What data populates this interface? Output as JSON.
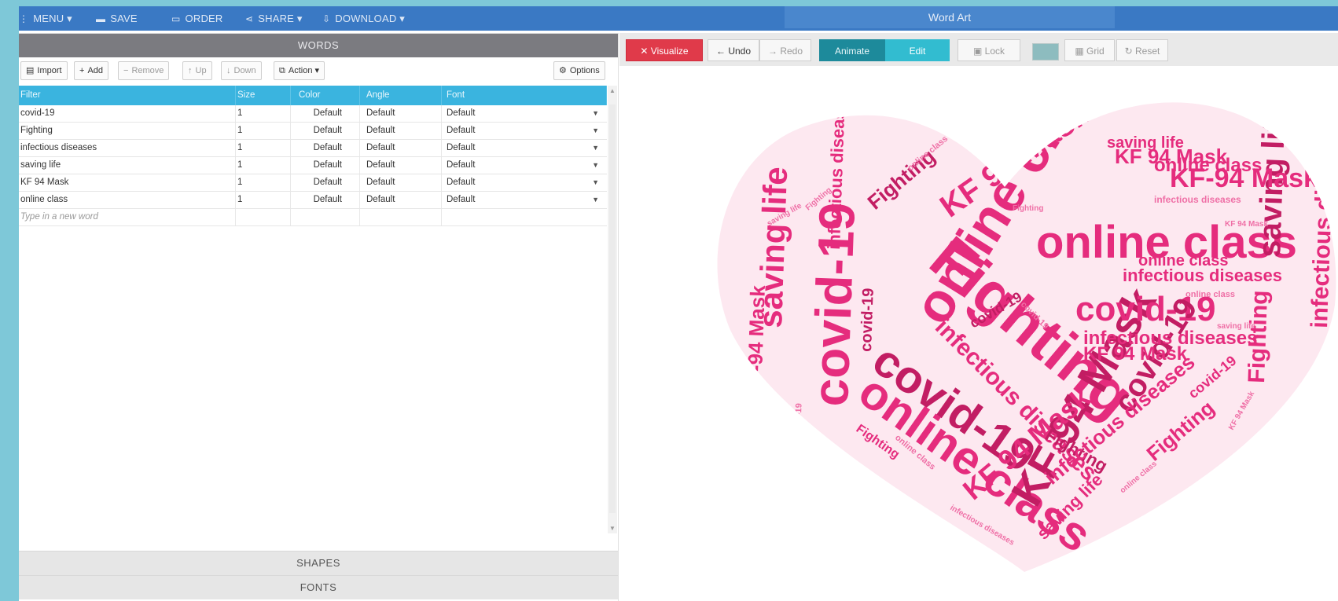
{
  "topbar": {
    "menu": "MENU",
    "save": "SAVE",
    "order": "ORDER",
    "share": "SHARE",
    "download": "DOWNLOAD",
    "app_title": "Word Art"
  },
  "words_panel": {
    "title": "WORDS",
    "toolbar": {
      "import": "Import",
      "add": "Add",
      "remove": "Remove",
      "up": "Up",
      "down": "Down",
      "action": "Action",
      "options": "Options"
    },
    "columns": [
      "Filter",
      "Size",
      "Color",
      "Angle",
      "Font"
    ],
    "rows": [
      {
        "word": "covid-19",
        "size": "1",
        "color": "Default",
        "angle": "Default",
        "font": "Default"
      },
      {
        "word": "Fighting",
        "size": "1",
        "color": "Default",
        "angle": "Default",
        "font": "Default"
      },
      {
        "word": "infectious diseases",
        "size": "1",
        "color": "Default",
        "angle": "Default",
        "font": "Default"
      },
      {
        "word": "saving life",
        "size": "1",
        "color": "Default",
        "angle": "Default",
        "font": "Default"
      },
      {
        "word": "KF 94 Mask",
        "size": "1",
        "color": "Default",
        "angle": "Default",
        "font": "Default"
      },
      {
        "word": "online class",
        "size": "1",
        "color": "Default",
        "angle": "Default",
        "font": "Default"
      }
    ],
    "new_word_placeholder": "Type in a new word"
  },
  "shapes_panel": {
    "title": "SHAPES"
  },
  "fonts_panel": {
    "title": "FONTS"
  },
  "art_toolbar": {
    "visualize": "Visualize",
    "undo": "Undo",
    "redo": "Redo",
    "animate": "Animate",
    "edit": "Edit",
    "lock": "Lock",
    "grid": "Grid",
    "reset": "Reset"
  },
  "art_words": {
    "covid": "covid-19",
    "fighting": "Fighting",
    "infectious": "infectious diseases",
    "saving": "saving life",
    "mask": "KF 94 Mask",
    "mask_alt": "KF-94 Mask",
    "online": "online class"
  },
  "colors": {
    "accent": "#3a79c4",
    "table_header": "#3ab4df",
    "visualize": "#e03a4a",
    "animate": "#1d8a9b",
    "edit": "#32bcd0",
    "word_pink": "#e52c7d"
  }
}
